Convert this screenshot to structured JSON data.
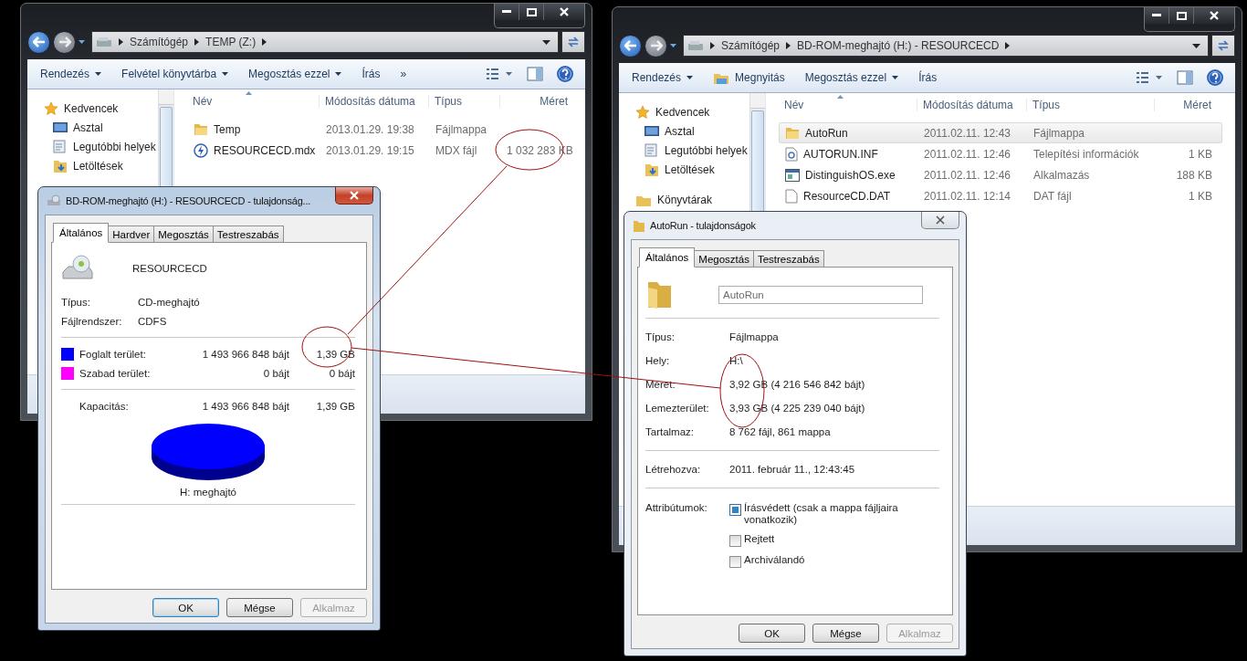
{
  "explorers": [
    {
      "address": [
        "Számítógép",
        "TEMP (Z:)"
      ],
      "toolbar": [
        {
          "kind": "menu",
          "label": "Rendezés",
          "dropdown": true
        },
        {
          "kind": "menu",
          "label": "Felvétel könyvtárba",
          "dropdown": true
        },
        {
          "kind": "menu",
          "label": "Megosztás ezzel",
          "dropdown": true
        },
        {
          "kind": "command",
          "label": "Írás",
          "dropdown": false
        }
      ],
      "overflow": "»",
      "nav": [
        {
          "kind": "favorites",
          "label": "Kedvencek"
        },
        {
          "kind": "desktop",
          "label": "Asztal"
        },
        {
          "kind": "recent",
          "label": "Legutóbbi helyek"
        },
        {
          "kind": "downloads",
          "label": "Letöltések"
        }
      ],
      "columns": [
        "Név",
        "Módosítás dátuma",
        "Típus",
        "Méret"
      ],
      "rows": [
        {
          "kind": "folder",
          "name": "Temp",
          "date": "2013.01.29. 19:38",
          "type": "Fájlmappa",
          "selected": false
        },
        {
          "kind": "mdx",
          "name": "RESOURCECD.mdx",
          "date": "2013.01.29. 19:15",
          "type": "MDX fájl",
          "size": "1 032 283 KB",
          "selected": false
        }
      ]
    },
    {
      "address": [
        "Számítógép",
        "BD-ROM-meghajtó (H:) - RESOURCECD"
      ],
      "toolbar": [
        {
          "kind": "menu",
          "label": "Rendezés",
          "dropdown": true
        },
        {
          "kind": "open",
          "label": "Megnyitás",
          "dropdown": false
        },
        {
          "kind": "menu",
          "label": "Megosztás ezzel",
          "dropdown": true
        },
        {
          "kind": "command",
          "label": "Írás",
          "dropdown": false
        }
      ],
      "nav": [
        {
          "kind": "favorites",
          "label": "Kedvencek"
        },
        {
          "kind": "desktop",
          "label": "Asztal"
        },
        {
          "kind": "recent",
          "label": "Legutóbbi helyek"
        },
        {
          "kind": "downloads",
          "label": "Letöltések"
        },
        {
          "kind": "libraries",
          "label": "Könyvtárak"
        }
      ],
      "columns": [
        "Név",
        "Módosítás dátuma",
        "Típus",
        "Méret"
      ],
      "rows": [
        {
          "kind": "folder",
          "name": "AutoRun",
          "date": "2011.02.11. 12:43",
          "type": "Fájlmappa",
          "selected": true
        },
        {
          "kind": "inf",
          "name": "AUTORUN.INF",
          "date": "2011.02.11. 12:46",
          "type": "Telepítési információk",
          "size": "1 KB",
          "selected": false
        },
        {
          "kind": "exe",
          "name": "DistinguishOS.exe",
          "date": "2011.02.11. 12:46",
          "type": "Alkalmazás",
          "size": "188 KB",
          "selected": false
        },
        {
          "kind": "dat",
          "name": "ResourceCD.DAT",
          "date": "2011.02.11. 12:14",
          "type": "DAT fájl",
          "size": "1 KB",
          "selected": false
        }
      ]
    }
  ],
  "drive_dialog": {
    "title": "BD-ROM-meghajtó (H:) - RESOURCECD - tulajdonság...",
    "active": true,
    "tabs": [
      {
        "label": "Általános",
        "selected": true
      },
      {
        "label": "Hardver",
        "selected": false
      },
      {
        "label": "Megosztás",
        "selected": false
      },
      {
        "label": "Testreszabás",
        "selected": false
      }
    ],
    "name": "RESOURCECD",
    "info": [
      {
        "label": "Típus:",
        "value": "CD-meghajtó"
      },
      {
        "label": "Fájlrendszer:",
        "value": "CDFS"
      }
    ],
    "space": [
      {
        "color": "#0000ff",
        "label": "Foglalt terület:",
        "bytes": "1 493 966 848 bájt",
        "size": "1,39 GB"
      },
      {
        "color": "#ff00ff",
        "label": "Szabad terület:",
        "bytes": "0 bájt",
        "size": "0 bájt"
      }
    ],
    "capacity": {
      "label": "Kapacitás:",
      "bytes": "1 493 966 848 bájt",
      "size": "1,39 GB"
    },
    "pie_label": "H: meghajtó",
    "buttons": [
      {
        "label": "OK",
        "default": true,
        "disabled": false
      },
      {
        "label": "Mégse",
        "default": false,
        "disabled": false
      },
      {
        "label": "Alkalmaz",
        "default": false,
        "disabled": true
      }
    ]
  },
  "folder_dialog": {
    "title": "AutoRun - tulajdonságok",
    "active": false,
    "tabs": [
      {
        "label": "Általános",
        "selected": true
      },
      {
        "label": "Megosztás",
        "selected": false
      },
      {
        "label": "Testreszabás",
        "selected": false
      }
    ],
    "name": "AutoRun",
    "groups": [
      [
        {
          "label": "Típus:",
          "value": "Fájlmappa"
        },
        {
          "label": "Hely:",
          "value": "H:\\"
        },
        {
          "label": "Méret:",
          "value": "3,92 GB (4 216 546 842 bájt)"
        },
        {
          "label": "Lemezterület:",
          "value": "3,93 GB (4 225 239 040 bájt)"
        },
        {
          "label": "Tartalmaz:",
          "value": "8 762 fájl, 861 mappa"
        }
      ],
      [
        {
          "label": "Létrehozva:",
          "value": "2011. február 11., 12:43:45"
        }
      ]
    ],
    "attributes_label": "Attribútumok:",
    "attributes": [
      {
        "label": "Írásvédett (csak a mappa fájljaira vonatkozik)",
        "checked": false,
        "indeterminate": true
      },
      {
        "label": "Rejtett",
        "checked": false,
        "indeterminate": false
      },
      {
        "label": "Archiválandó",
        "checked": false,
        "indeterminate": false
      }
    ],
    "buttons": [
      {
        "label": "OK",
        "default": false,
        "disabled": false
      },
      {
        "label": "Mégse",
        "default": false,
        "disabled": false
      },
      {
        "label": "Alkalmaz",
        "default": false,
        "disabled": true
      }
    ]
  }
}
